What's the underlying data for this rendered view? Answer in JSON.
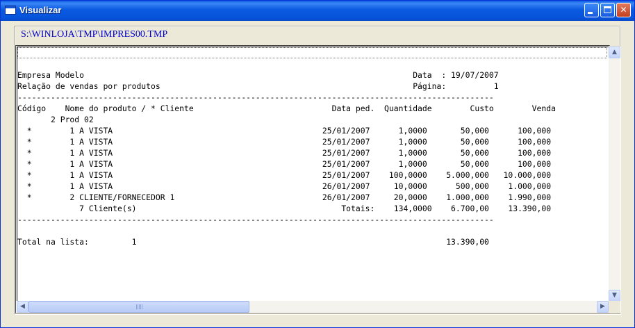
{
  "window": {
    "title": "Visualizar"
  },
  "file_path": "S:\\WINLOJA\\TMP\\IMPRES00.TMP",
  "report_lines": [
    "Empresa Modelo                                                                     Data  : 19/07/2007",
    "Relação de vendas por produtos                                                     Página:          1",
    "----------------------------------------------------------------------------------------------------",
    "Código    Nome do produto / * Cliente                             Data ped.  Quantidade        Custo        Venda",
    "       2 Prod 02",
    "  *        1 A VISTA                                            25/01/2007      1,0000       50,000      100,000",
    "  *        1 A VISTA                                            25/01/2007      1,0000       50,000      100,000",
    "  *        1 A VISTA                                            25/01/2007      1,0000       50,000      100,000",
    "  *        1 A VISTA                                            25/01/2007      1,0000       50,000      100,000",
    "  *        1 A VISTA                                            25/01/2007    100,0000    5.000,000   10.000,000",
    "  *        1 A VISTA                                            26/01/2007     10,0000      500,000    1.000,000",
    "  *        2 CLIENTE/FORNECEDOR 1                               26/01/2007     20,0000    1.000,000    1.990,000",
    "             7 Cliente(s)                                           Totais:    134,0000    6.700,00    13.390,00",
    "----------------------------------------------------------------------------------------------------",
    "",
    "Total na lista:         1                                                                 13.390,00"
  ],
  "icons": {
    "app": "window-icon",
    "minimize": "minimize-icon",
    "maximize": "maximize-icon",
    "close": "close-icon"
  },
  "colors": {
    "titlebar": "#0a5ae0",
    "path_text": "#0000c8"
  }
}
